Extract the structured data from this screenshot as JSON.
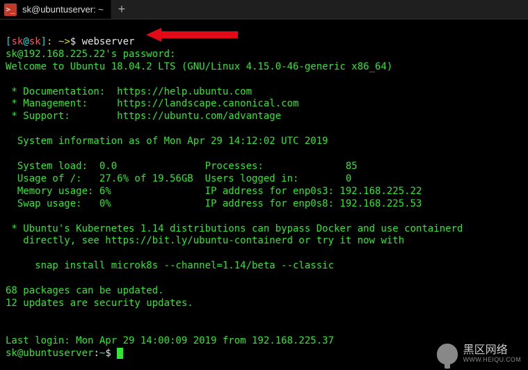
{
  "tab": {
    "title": "sk@ubuntuserver: ~",
    "icon_glyph": ">_"
  },
  "newtab_glyph": "+",
  "prompt1": {
    "open": "[",
    "user": "sk",
    "at": "@",
    "host": "sk",
    "close": "]",
    "path": ": ~>",
    "dollar": "$ ",
    "cmd": "webserver"
  },
  "lines": {
    "pw": "sk@192.168.225.22's password:",
    "welcome": "Welcome to Ubuntu 18.04.2 LTS (GNU/Linux 4.15.0-46-generic x86_64)",
    "doc": " * Documentation:  https://help.ubuntu.com",
    "mgmt": " * Management:     https://landscape.canonical.com",
    "sup": " * Support:        https://ubuntu.com/advantage",
    "sysinfo": "  System information as of Mon Apr 29 14:12:02 UTC 2019",
    "row1": "  System load:  0.0               Processes:              85",
    "row2": "  Usage of /:   27.6% of 19.56GB  Users logged in:        0",
    "row3": "  Memory usage: 6%                IP address for enp0s3: 192.168.225.22",
    "row4": "  Swap usage:   0%                IP address for enp0s8: 192.168.225.53",
    "kub1": " * Ubuntu's Kubernetes 1.14 distributions can bypass Docker and use containerd",
    "kub2": "   directly, see https://bit.ly/ubuntu-containerd or try it now with",
    "snap": "     snap install microk8s --channel=1.14/beta --classic",
    "pkg1": "68 packages can be updated.",
    "pkg2": "12 updates are security updates.",
    "last": "Last login: Mon Apr 29 14:00:09 2019 from 192.168.225.37"
  },
  "prompt2": {
    "user": "sk",
    "at": "@",
    "host": "ubuntuserver",
    "colon": ":",
    "path": "~",
    "dollar": "$ "
  },
  "watermark": {
    "cn": "黑区网络",
    "en": "WWW.HEIQU.COM"
  }
}
